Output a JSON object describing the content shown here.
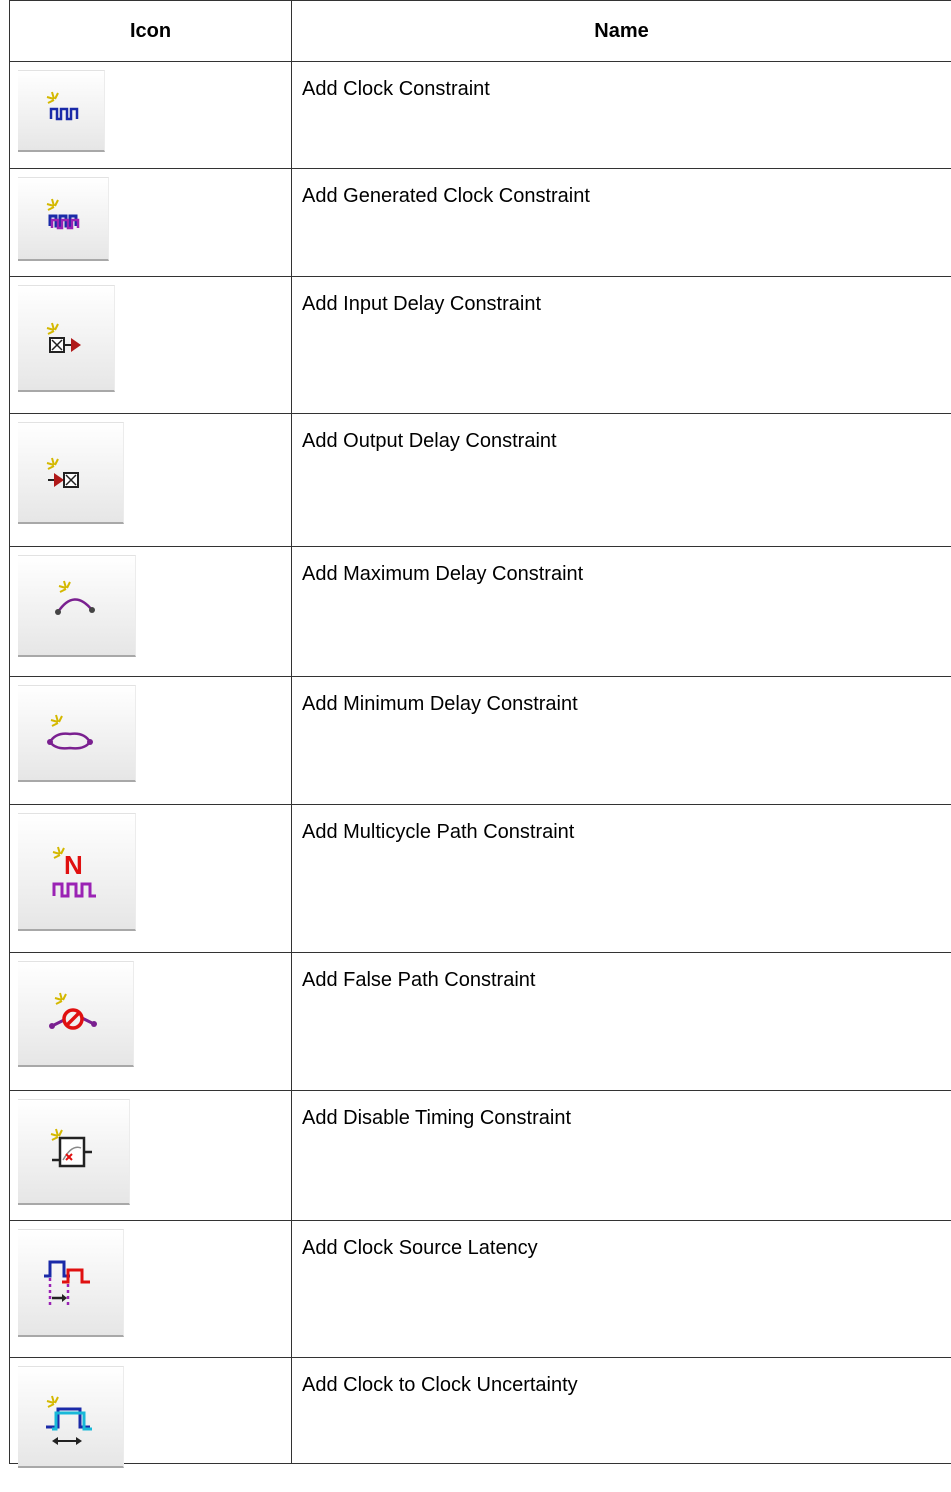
{
  "table": {
    "headers": {
      "icon": "Icon",
      "name": "Name"
    },
    "rows": [
      {
        "icon": "clock-icon",
        "name": "Add Clock Constraint"
      },
      {
        "icon": "generated-clock-icon",
        "name": "Add Generated Clock Constraint"
      },
      {
        "icon": "input-delay-icon",
        "name": "Add Input Delay Constraint"
      },
      {
        "icon": "output-delay-icon",
        "name": "Add Output Delay Constraint"
      },
      {
        "icon": "maximum-delay-icon",
        "name": "Add Maximum Delay Constraint"
      },
      {
        "icon": "minimum-delay-icon",
        "name": "Add Minimum Delay Constraint"
      },
      {
        "icon": "multicycle-path-icon",
        "name": "Add Multicycle Path Constraint"
      },
      {
        "icon": "false-path-icon",
        "name": "Add False Path Constraint"
      },
      {
        "icon": "disable-timing-icon",
        "name": "Add Disable Timing Constraint"
      },
      {
        "icon": "clock-source-latency-icon",
        "name": "Add Clock Source Latency"
      },
      {
        "icon": "clock-uncertainty-icon",
        "name": "Add Clock to Clock Uncertainty"
      }
    ]
  }
}
